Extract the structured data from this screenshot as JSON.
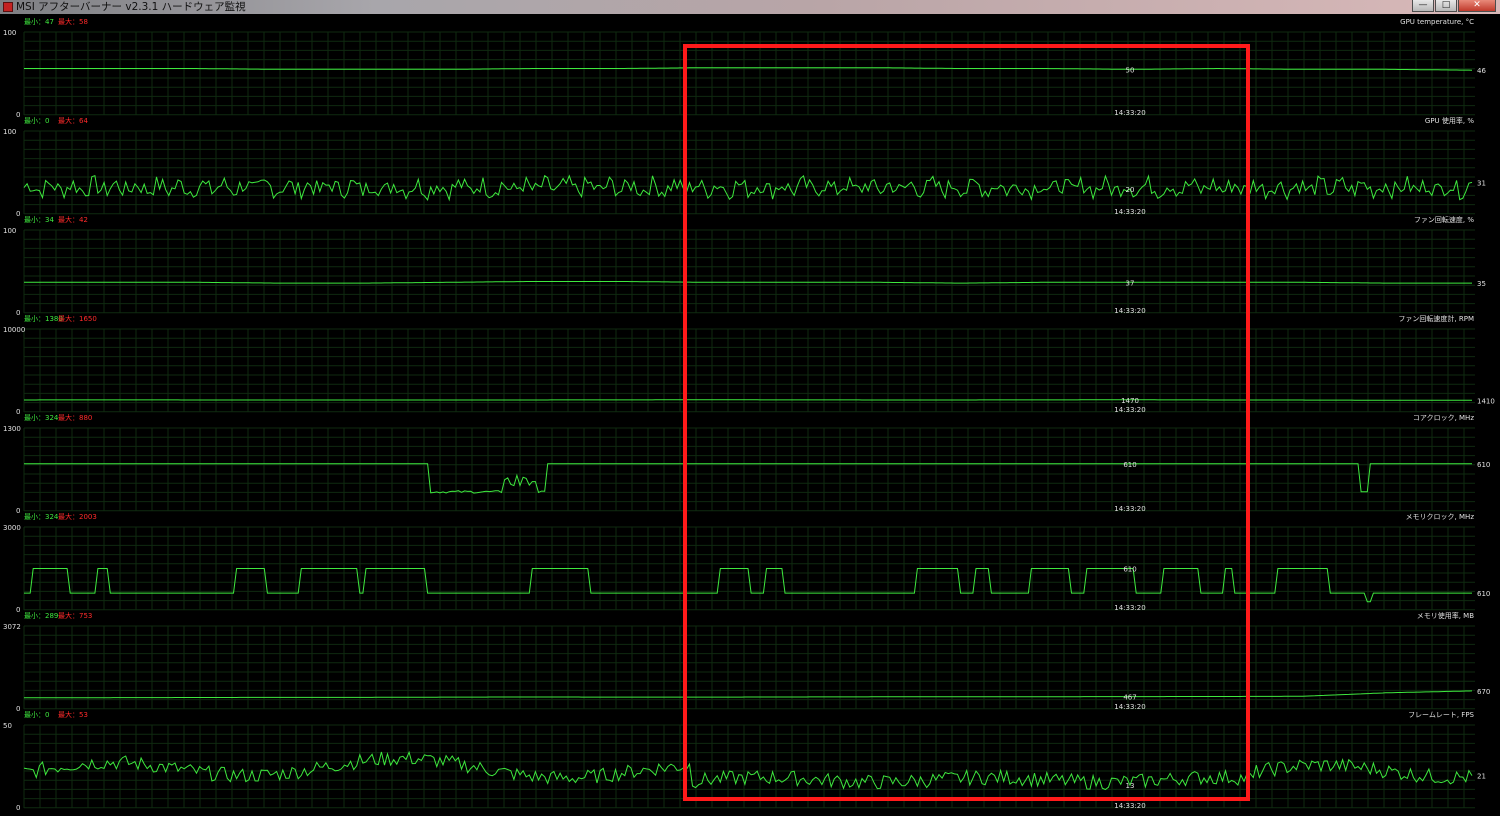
{
  "window": {
    "title": "MSI アフターバーナー v2.3.1 ハードウェア監視",
    "buttons": {
      "minimize": "—",
      "maximize": "□",
      "close": "✕"
    }
  },
  "monitor": {
    "min_label": "最小",
    "max_label": "最大",
    "time_label": "14:33:20",
    "colors": {
      "line": "#3ee83e",
      "min_text": "#3ee83e",
      "max_text": "#ff2a2a",
      "grid": "#0f2a10",
      "label": "#e0e0e0"
    },
    "panels": [
      {
        "name": "GPU temperature, °C",
        "min": "47",
        "max": "58",
        "top": "100",
        "bottom": "0",
        "current": "46",
        "cursor": "50",
        "kind": "flat",
        "values": [
          56,
          56,
          56,
          55,
          55,
          55,
          56,
          56,
          57,
          57,
          57,
          56,
          56,
          55,
          56,
          55,
          55,
          54
        ]
      },
      {
        "name": "GPU 使用率, %",
        "min": "0",
        "max": "64",
        "top": "100",
        "bottom": "0",
        "current": "31",
        "cursor": "20",
        "kind": "noisy",
        "base": 32,
        "amp": 11
      },
      {
        "name": "ファン回転速度, %",
        "min": "34",
        "max": "42",
        "top": "100",
        "bottom": "0",
        "current": "35",
        "cursor": "37",
        "kind": "flat",
        "values": [
          37,
          37,
          37,
          36,
          36,
          37,
          38,
          38,
          37,
          37,
          37,
          36,
          37,
          37,
          37,
          37,
          36,
          36
        ]
      },
      {
        "name": "ファン回転速度計, RPM",
        "min": "1380",
        "max": "1650",
        "top": "10000",
        "bottom": "0",
        "current": "1410",
        "cursor": "1470",
        "kind": "flat",
        "values": [
          1450,
          1460,
          1450,
          1450,
          1440,
          1440,
          1450,
          1460,
          1470,
          1460,
          1450,
          1450,
          1460,
          1470,
          1450,
          1440,
          1420,
          1410
        ]
      },
      {
        "name": "コアクロック, MHz",
        "min": "324",
        "max": "880",
        "top": "1300",
        "bottom": "0",
        "current": "610",
        "cursor": "610",
        "kind": "core"
      },
      {
        "name": "メモリクロック, MHz",
        "min": "324",
        "max": "2003",
        "top": "3000",
        "bottom": "0",
        "current": "610",
        "cursor": "610",
        "kind": "mem"
      },
      {
        "name": "メモリ使用率, MB",
        "min": "289",
        "max": "753",
        "top": "3072",
        "bottom": "0",
        "current": "670",
        "cursor": "467",
        "kind": "flat",
        "values": [
          420,
          420,
          425,
          430,
          430,
          440,
          445,
          440,
          440,
          445,
          450,
          450,
          455,
          460,
          462,
          470,
          600,
          670
        ]
      },
      {
        "name": "フレームレート, FPS",
        "min": "0",
        "max": "53",
        "top": "50",
        "bottom": "0",
        "current": "21",
        "cursor": "13",
        "kind": "fps"
      }
    ]
  }
}
